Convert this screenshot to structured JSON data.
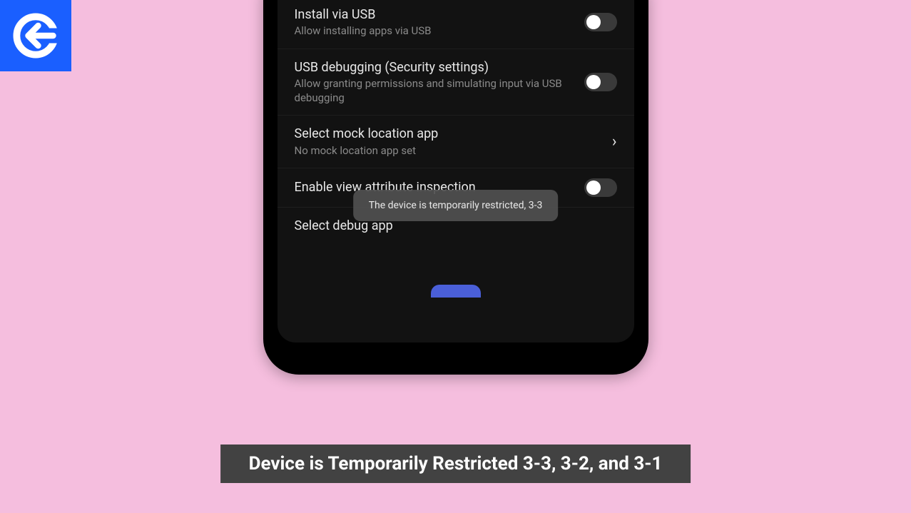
{
  "logo": {
    "name": "brand-logo"
  },
  "settings": {
    "items": [
      {
        "title": "Install via USB",
        "subtitle": "Allow installing apps via USB",
        "type": "toggle",
        "state": "off"
      },
      {
        "title": "USB debugging (Security settings)",
        "subtitle": "Allow granting permissions and simulating input via USB debugging",
        "type": "toggle",
        "state": "off"
      },
      {
        "title": "Select mock location app",
        "subtitle": "No mock location app set",
        "type": "navigate"
      },
      {
        "title": "Enable view attribute inspection",
        "subtitle": "",
        "type": "toggle",
        "state": "off"
      },
      {
        "title": "Select debug app",
        "subtitle": "",
        "type": "navigate"
      }
    ]
  },
  "toast": {
    "message": "The device is temporarily restricted, 3-3"
  },
  "caption": {
    "text": "Device is Temporarily Restricted 3-3,  3-2, and 3-1"
  }
}
